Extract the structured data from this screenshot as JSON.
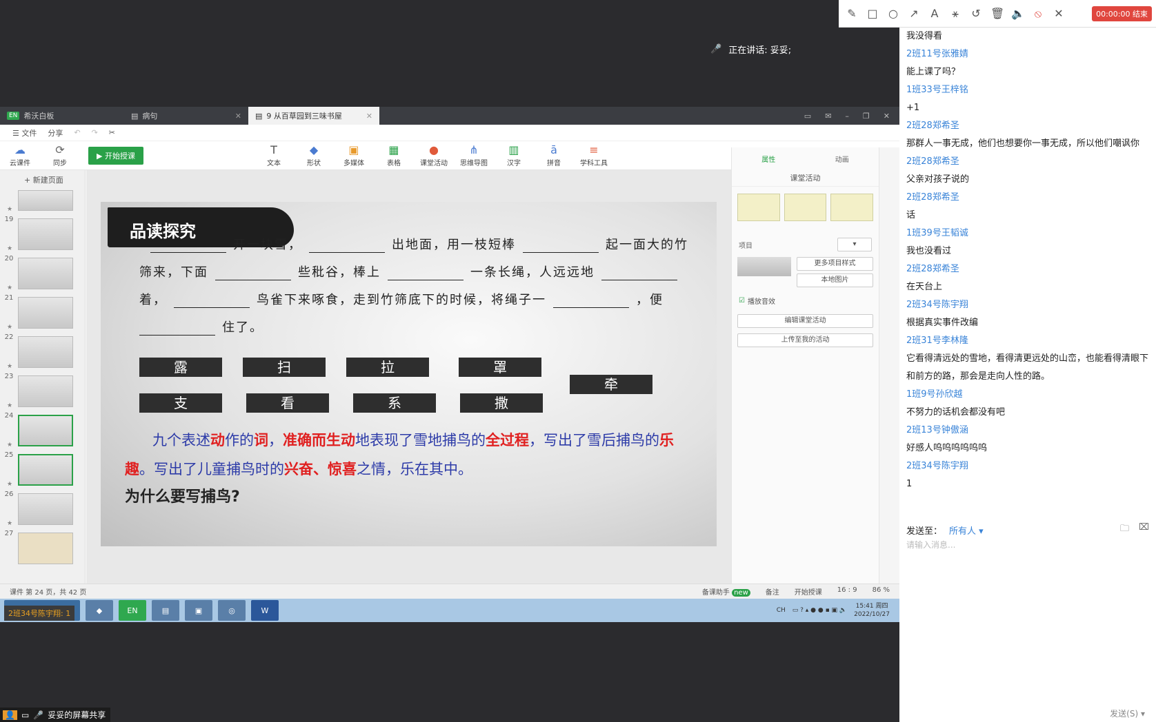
{
  "top_toolbar": {
    "icons": [
      "pencil-icon",
      "rectangle-icon",
      "circle-icon",
      "arrow-icon",
      "text-icon",
      "magic-wand-icon",
      "undo-icon",
      "trash-icon",
      "speaker-icon",
      "mic-off-icon",
      "close-icon"
    ],
    "timer": "00:00:00 结束"
  },
  "speaker": {
    "label": "正在讲话: 妥妥;"
  },
  "app": {
    "tabs": [
      {
        "label": "希沃白板",
        "badge": "EN"
      },
      {
        "label": "病句"
      },
      {
        "label": "9 从百草园到三味书屋"
      }
    ],
    "menu": {
      "file": "☰ 文件",
      "share": "分享"
    },
    "toolbar": {
      "cloud": "云课件",
      "sync": "同步",
      "start": "▶ 开始授课",
      "tools": [
        "文本",
        "形状",
        "多媒体",
        "表格",
        "课堂活动",
        "思维导图",
        "汉字",
        "拼音",
        "学科工具"
      ]
    },
    "thumbs": {
      "new_page": "+ 新建页面",
      "items": [
        "19",
        "20",
        "21",
        "22",
        "23",
        "24",
        "25",
        "26",
        "27"
      ]
    },
    "slide": {
      "title": "品读探究",
      "line1": [
        "开一块雪，",
        "出地面，用一枝短棒",
        "起一面大的竹"
      ],
      "line2": [
        "筛来，下面",
        "些秕谷，棒上",
        "一条长绳，人远远地"
      ],
      "line3": [
        "着，",
        "鸟雀下来啄食，走到竹筛底下的时候，将绳子一",
        "，便"
      ],
      "line4": "住了。",
      "words": [
        "露",
        "扫",
        "拉",
        "罩",
        "支",
        "看",
        "系",
        "撒",
        "牵"
      ],
      "summary": {
        "p1": "九个表述",
        "r1": "动",
        "p2": "作的",
        "r2": "词",
        "p3": "，",
        "r3": "准确而生动",
        "p4": "地表现了雪地捕鸟的",
        "r4": "全过程",
        "p5": "，写出了雪后捕鸟的",
        "r5": "乐趣",
        "p6": "。写出了儿童捕鸟时的",
        "r6": "兴奋、惊喜",
        "p7": "之情，乐在其中。"
      },
      "question": "为什么要写捕鸟?"
    },
    "props": {
      "tab_attr": "属性",
      "tab_anim": "动画",
      "head": "课堂活动",
      "item_label": "项目",
      "more_style": "更多项目样式",
      "local_img": "本地图片",
      "sound": "播放音效",
      "edit": "编辑课堂活动",
      "upload": "上传至我的活动"
    },
    "status": {
      "pages": "课件 第 24 页，共 42 页",
      "assistant": "备课助手",
      "new": "new",
      "notes": "备注",
      "start": "开始授课",
      "ratio": "16 : 9",
      "zoom": "86 %"
    },
    "taskbar": {
      "tooltip": "2班34号陈宇翔: 1",
      "apps": [
        "app1",
        "app2",
        "EN",
        "app4",
        "app5",
        "app6",
        "W"
      ],
      "time": "15:41 周四",
      "date": "2022/10/27",
      "lang": "CH"
    }
  },
  "chat": {
    "messages": [
      {
        "name": "",
        "text": "我没得看"
      },
      {
        "name": "2班11号张雅婧",
        "text": "能上课了吗？"
      },
      {
        "name": "1班33号王梓铭",
        "text": "+1"
      },
      {
        "name": "2班28郑希圣",
        "text": "那群人一事无成，他们也想要你一事无成，所以他们嘲讽你"
      },
      {
        "name": "2班28郑希圣",
        "text": "父亲对孩子说的"
      },
      {
        "name": "2班28郑希圣",
        "text": "话"
      },
      {
        "name": "1班39号王韬诚",
        "text": "我也没看过"
      },
      {
        "name": "2班28郑希圣",
        "text": "在天台上"
      },
      {
        "name": "2班34号陈宇翔",
        "text": "根据真实事件改编"
      },
      {
        "name": "2班31号李林隆",
        "text": "它看得清远处的雪地，看得清更远处的山峦，也能看得清眼下和前方的路，那会是走向人性的路。"
      },
      {
        "name": "1班9号孙欣越",
        "text": "不努力的话机会都没有吧"
      },
      {
        "name": "2班13号钟傲涵",
        "text": "好感人呜呜呜呜呜呜"
      },
      {
        "name": "2班34号陈宇翔",
        "text": "1"
      }
    ],
    "send_to_label": "发送至：",
    "send_to_value": "所有人 ▾",
    "placeholder": "请输入消息...",
    "send_button": "发送(S)"
  },
  "share_bar": {
    "label": "妥妥的屏幕共享"
  }
}
